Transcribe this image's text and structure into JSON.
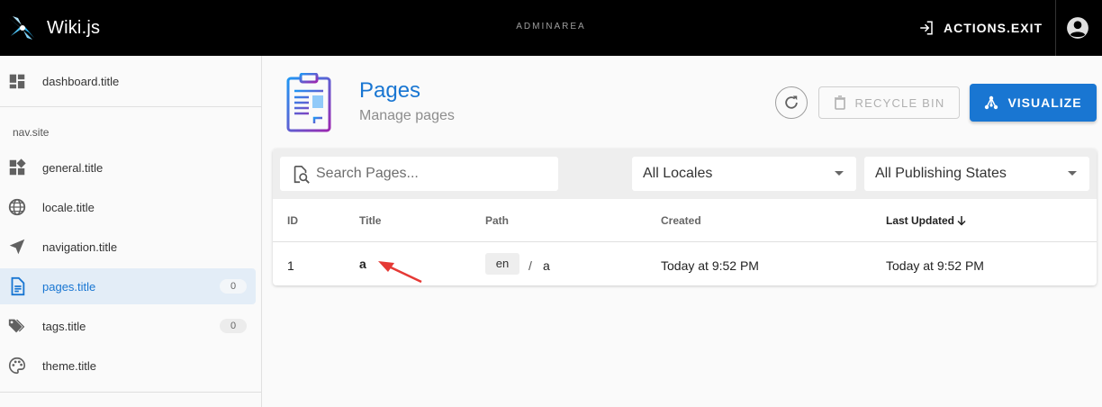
{
  "app": {
    "name": "Wiki.js",
    "area_label": "ADMINAREA",
    "exit_label": "ACTIONS.EXIT"
  },
  "sidebar": {
    "top_item": {
      "label": "dashboard.title",
      "icon": "dashboard-icon"
    },
    "section_header": "nav.site",
    "items": [
      {
        "label": "general.title",
        "icon": "widgets-icon",
        "badge": ""
      },
      {
        "label": "locale.title",
        "icon": "globe-icon",
        "badge": ""
      },
      {
        "label": "navigation.title",
        "icon": "navigation-arrow-icon",
        "badge": ""
      },
      {
        "label": "pages.title",
        "icon": "file-document-icon",
        "badge": "0",
        "active": true
      },
      {
        "label": "tags.title",
        "icon": "tags-icon",
        "badge": "0"
      },
      {
        "label": "theme.title",
        "icon": "palette-icon",
        "badge": ""
      }
    ]
  },
  "header": {
    "title": "Pages",
    "subtitle": "Manage pages",
    "recycle_label": "RECYCLE BIN",
    "visualize_label": "VISUALIZE"
  },
  "filters": {
    "search_placeholder": "Search Pages...",
    "search_value": "",
    "locale_selected": "All Locales",
    "state_selected": "All Publishing States"
  },
  "table": {
    "columns": [
      "ID",
      "Title",
      "Path",
      "Created",
      "Last Updated"
    ],
    "sort_column": "Last Updated",
    "rows": [
      {
        "id": "1",
        "title": "a",
        "locale": "en",
        "path_sep": "/",
        "path": "a",
        "created": "Today at 9:52 PM",
        "updated": "Today at 9:52 PM"
      }
    ]
  },
  "colors": {
    "primary": "#1976d2",
    "topbar": "#000000",
    "active_bg": "#e3edf7",
    "annotation": "#e53935"
  }
}
